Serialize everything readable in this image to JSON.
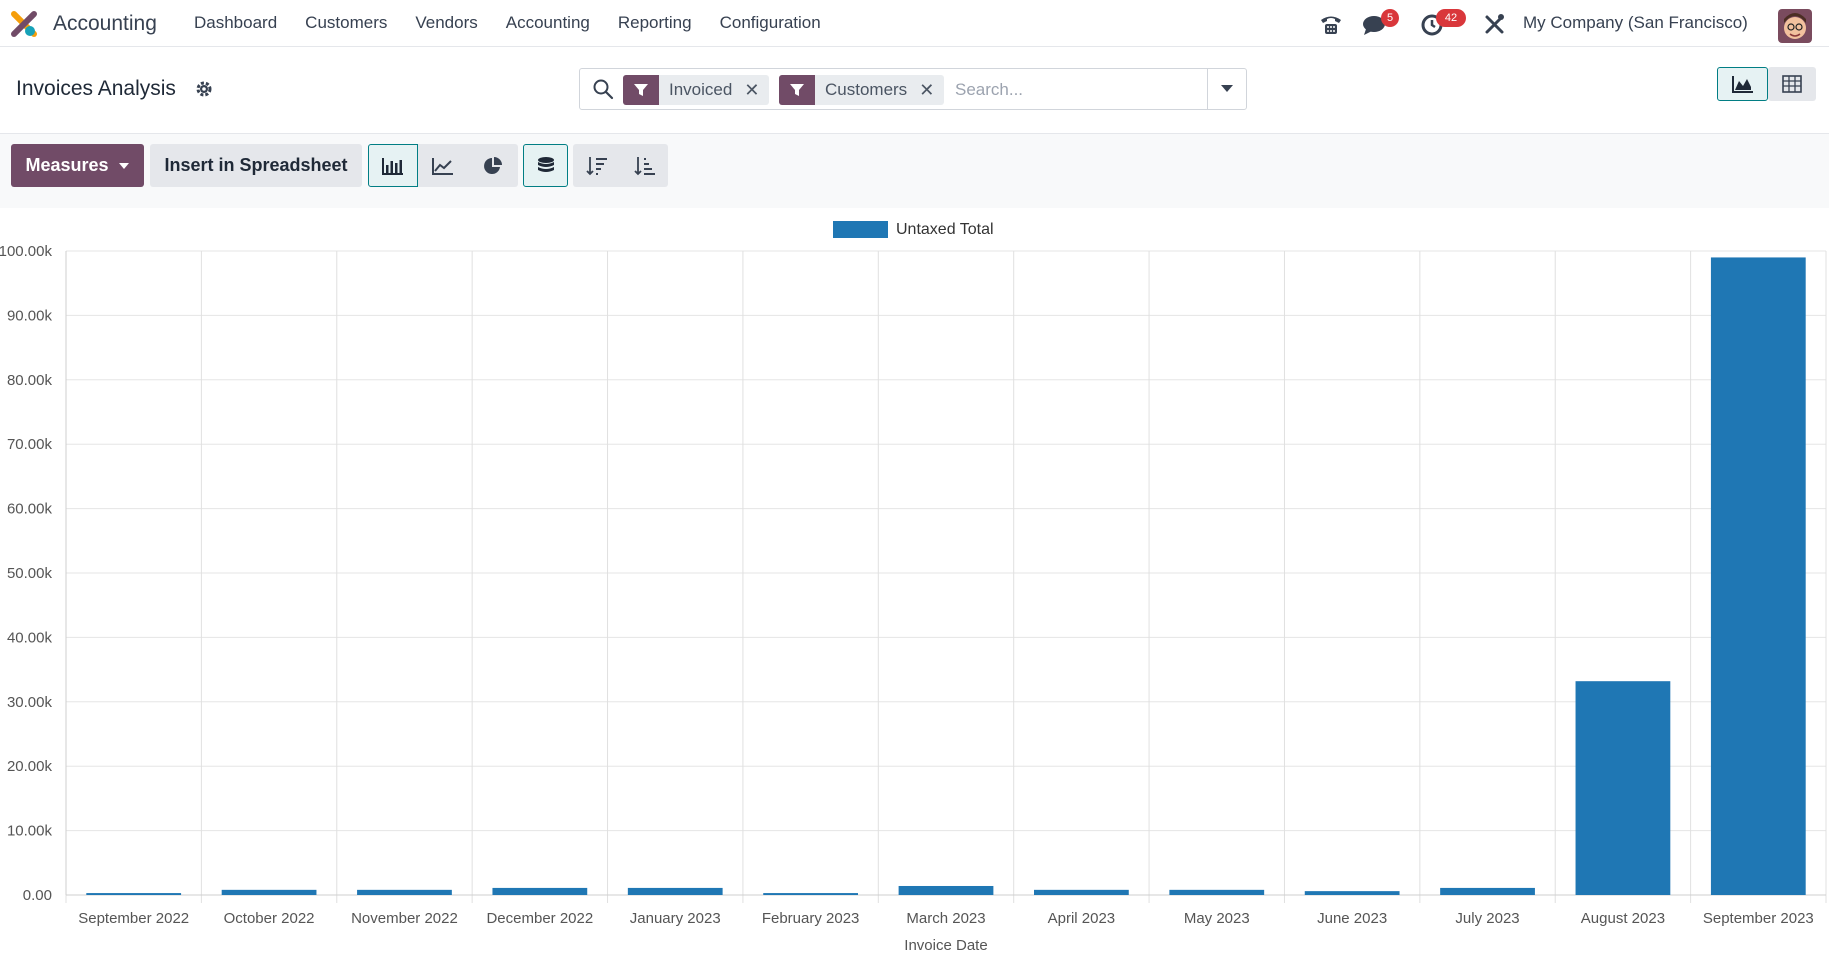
{
  "app": {
    "title": "Accounting",
    "menu": [
      "Dashboard",
      "Customers",
      "Vendors",
      "Accounting",
      "Reporting",
      "Configuration"
    ],
    "company": "My Company (San Francisco)",
    "messages_badge": "5",
    "activities_badge": "42",
    "icons": [
      "phone-icon",
      "chat-icon",
      "clock-icon",
      "tools-icon",
      "avatar"
    ]
  },
  "control": {
    "breadcrumb": "Invoices Analysis",
    "facets": [
      {
        "label": "Invoiced"
      },
      {
        "label": "Customers"
      }
    ],
    "search_placeholder": "Search..."
  },
  "buttons": {
    "measures": "Measures",
    "insert": "Insert in Spreadsheet"
  },
  "colors": {
    "primary": "#714b67",
    "accent": "#017e84",
    "bar": "#1f77b4"
  },
  "chart_data": {
    "type": "bar",
    "categories": [
      "September 2022",
      "October 2022",
      "November 2022",
      "December 2022",
      "January 2023",
      "February 2023",
      "March 2023",
      "April 2023",
      "May 2023",
      "June 2023",
      "July 2023",
      "August 2023",
      "September 2023"
    ],
    "series": [
      {
        "name": "Untaxed Total",
        "values": [
          300,
          800,
          800,
          1100,
          1100,
          300,
          1400,
          800,
          800,
          600,
          1100,
          33200,
          99000
        ]
      }
    ],
    "xlabel": "Invoice Date",
    "ylabel": "",
    "ylim": [
      0,
      100000
    ],
    "yticks": [
      "0.00",
      "10.00k",
      "20.00k",
      "30.00k",
      "40.00k",
      "50.00k",
      "60.00k",
      "70.00k",
      "80.00k",
      "90.00k",
      "100.00k"
    ],
    "legend_position": "top-center",
    "grid": true
  }
}
